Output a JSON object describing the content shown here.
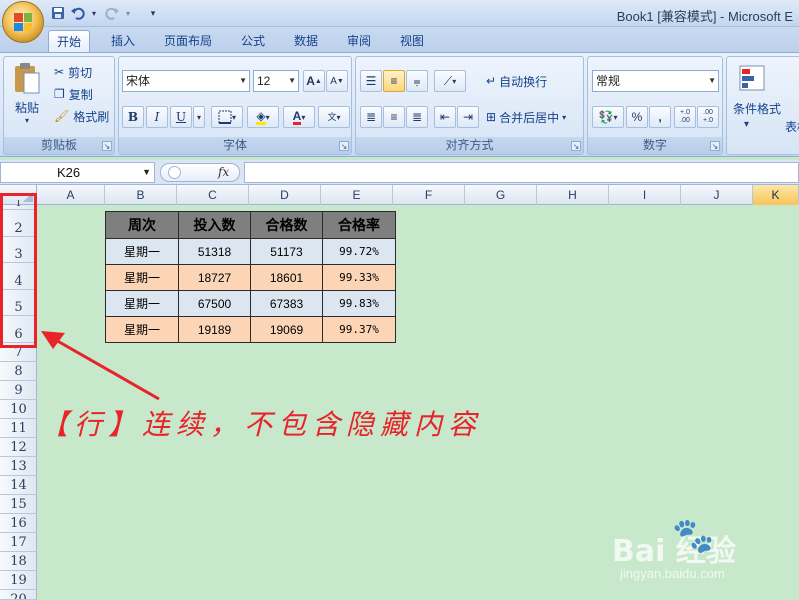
{
  "window": {
    "title": "Book1  [兼容模式] - Microsoft E"
  },
  "tabs": [
    {
      "label": "开始",
      "active": true
    },
    {
      "label": "插入"
    },
    {
      "label": "页面布局"
    },
    {
      "label": "公式"
    },
    {
      "label": "数据"
    },
    {
      "label": "审阅"
    },
    {
      "label": "视图"
    }
  ],
  "ribbon": {
    "clipboard": {
      "label": "剪贴板",
      "paste": "粘贴",
      "cut": "剪切",
      "copy": "复制",
      "format_painter": "格式刷"
    },
    "font": {
      "label": "字体",
      "font_name": "宋体",
      "font_size": "12",
      "bold": "B",
      "italic": "I",
      "underline": "U",
      "grow": "A",
      "shrink": "A",
      "phonetic": "wén"
    },
    "alignment": {
      "label": "对齐方式",
      "wrap_text": "自动换行",
      "merge_center": "合并后居中"
    },
    "number": {
      "label": "数字",
      "format": "常规",
      "percent": "%",
      "comma": ",",
      "inc_decimal": "+.0 .00",
      "dec_decimal": ".00 +.0"
    },
    "styles": {
      "conditional": "条件格式",
      "table": "表格"
    }
  },
  "formula_bar": {
    "name_box": "K26",
    "fx": "fx",
    "value": ""
  },
  "columns": [
    "A",
    "B",
    "C",
    "D",
    "E",
    "F",
    "G",
    "H",
    "I",
    "J",
    "K"
  ],
  "selected_column": "K",
  "rows": [
    "1",
    "2",
    "3",
    "4",
    "5",
    "6",
    "7",
    "8",
    "9",
    "10",
    "11",
    "12",
    "13",
    "14",
    "15",
    "16",
    "17",
    "18",
    "19",
    "20"
  ],
  "table": {
    "headers": [
      "周次",
      "投入数",
      "合格数",
      "合格率"
    ],
    "rows": [
      [
        "星期一",
        "51318",
        "51173",
        "99.72%"
      ],
      [
        "星期一",
        "18727",
        "18601",
        "99.33%"
      ],
      [
        "星期一",
        "67500",
        "67383",
        "99.83%"
      ],
      [
        "星期一",
        "19189",
        "19069",
        "99.37%"
      ]
    ],
    "colors": {
      "header": "#7f7f7f",
      "blue": "#dce6f1",
      "orange": "#fbd5b5"
    }
  },
  "annotation": {
    "text": "【行】连续，不包含隐藏内容",
    "color": "#e8242a"
  },
  "watermark": {
    "logo": "Bai 经验",
    "url": "jingyan.baidu.com"
  }
}
